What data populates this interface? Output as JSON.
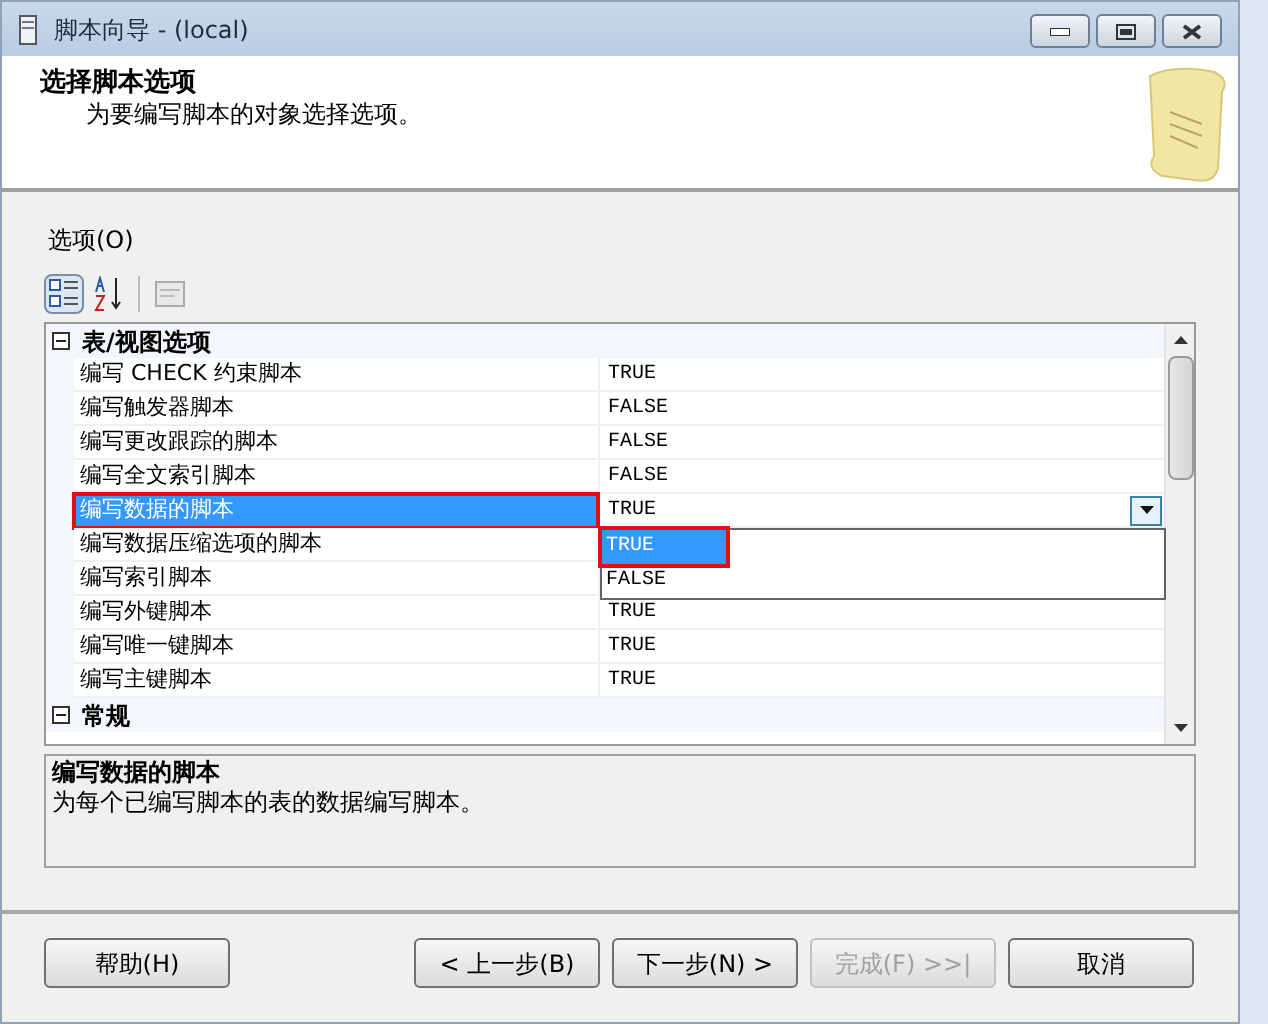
{
  "window": {
    "title": "脚本向导 - (local)"
  },
  "header": {
    "title": "选择脚本选项",
    "subtitle": "为要编写脚本的对象选择选项。"
  },
  "options_label": "选项(O)",
  "toolbar": [
    {
      "kind": "categorized",
      "selected": true
    },
    {
      "kind": "alphabetical",
      "selected": false
    },
    {
      "kind": "pages",
      "selected": false
    }
  ],
  "grid": {
    "categories": [
      {
        "name": "表/视图选项",
        "expanded": true,
        "rows": [
          {
            "name": "编写 CHECK 约束脚本",
            "value": "TRUE",
            "selected": false,
            "highlighted": false
          },
          {
            "name": "编写触发器脚本",
            "value": "FALSE",
            "selected": false,
            "highlighted": false
          },
          {
            "name": "编写更改跟踪的脚本",
            "value": "FALSE",
            "selected": false,
            "highlighted": false
          },
          {
            "name": "编写全文索引脚本",
            "value": "FALSE",
            "selected": false,
            "highlighted": false
          },
          {
            "name": "编写数据的脚本",
            "value": "TRUE",
            "selected": true,
            "highlighted": true
          },
          {
            "name": "编写数据压缩选项的脚本",
            "selected": false,
            "highlighted": false
          },
          {
            "name": "编写索引脚本",
            "selected": false,
            "highlighted": false
          },
          {
            "name": "编写外键脚本",
            "value": "TRUE",
            "selected": false,
            "highlighted": false
          },
          {
            "name": "编写唯一键脚本",
            "value": "TRUE",
            "selected": false,
            "highlighted": false
          },
          {
            "name": "编写主键脚本",
            "value": "TRUE",
            "selected": false,
            "highlighted": false
          }
        ]
      },
      {
        "name": "常规",
        "expanded": true
      }
    ]
  },
  "dropdown": {
    "options": [
      {
        "label": "TRUE",
        "selected": true,
        "highlighted": true
      },
      {
        "label": "FALSE",
        "selected": false,
        "highlighted": false
      }
    ]
  },
  "description": {
    "title": "编写数据的脚本",
    "text": "为每个已编写脚本的表的数据编写脚本。"
  },
  "buttons": [
    {
      "label": "帮助(H)",
      "disabled": false
    },
    {
      "label": "< 上一步(B)",
      "disabled": false
    },
    {
      "label": "下一步(N) >",
      "disabled": false
    },
    {
      "label": "完成(F) >>|",
      "disabled": true
    },
    {
      "label": "取消",
      "disabled": false
    }
  ]
}
